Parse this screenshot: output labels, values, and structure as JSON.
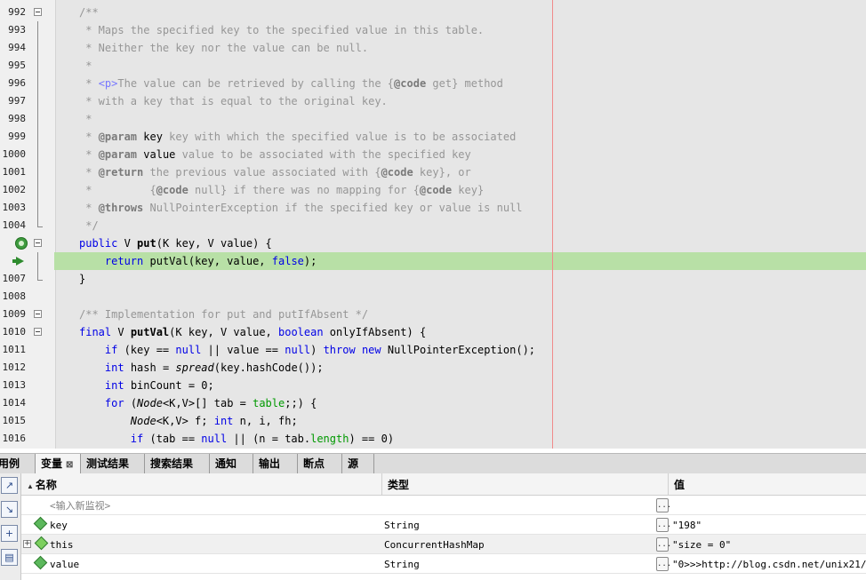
{
  "editor": {
    "lines": [
      {
        "n": "992",
        "parts": [
          {
            "t": "/**",
            "c": "cm"
          }
        ]
      },
      {
        "n": "993",
        "parts": [
          {
            "t": " * Maps the specified key to the specified value in this table.",
            "c": "cm"
          }
        ]
      },
      {
        "n": "994",
        "parts": [
          {
            "t": " * Neither the key nor the value can be null.",
            "c": "cm"
          }
        ]
      },
      {
        "n": "995",
        "parts": [
          {
            "t": " *",
            "c": "cm"
          }
        ]
      },
      {
        "n": "996",
        "parts": [
          {
            "t": " * ",
            "c": "cm"
          },
          {
            "t": "<p>",
            "c": "tag"
          },
          {
            "t": "The value can be retrieved by calling the {",
            "c": "cm"
          },
          {
            "t": "@code",
            "c": "cb"
          },
          {
            "t": " get} method",
            "c": "cm"
          }
        ]
      },
      {
        "n": "997",
        "parts": [
          {
            "t": " * with a key that is equal to the original key.",
            "c": "cm"
          }
        ]
      },
      {
        "n": "998",
        "parts": [
          {
            "t": " *",
            "c": "cm"
          }
        ]
      },
      {
        "n": "999",
        "parts": [
          {
            "t": " * ",
            "c": "cm"
          },
          {
            "t": "@param",
            "c": "cb"
          },
          {
            "t": " key",
            "c": "ck"
          },
          {
            "t": " key with which the specified value is to be associated",
            "c": "cm"
          }
        ]
      },
      {
        "n": "1000",
        "parts": [
          {
            "t": " * ",
            "c": "cm"
          },
          {
            "t": "@param",
            "c": "cb"
          },
          {
            "t": " value",
            "c": "ck"
          },
          {
            "t": " value to be associated with the specified key",
            "c": "cm"
          }
        ]
      },
      {
        "n": "1001",
        "parts": [
          {
            "t": " * ",
            "c": "cm"
          },
          {
            "t": "@return",
            "c": "cb"
          },
          {
            "t": " the previous value associated with {",
            "c": "cm"
          },
          {
            "t": "@code",
            "c": "cb"
          },
          {
            "t": " key}, or",
            "c": "cm"
          }
        ]
      },
      {
        "n": "1002",
        "parts": [
          {
            "t": " *         {",
            "c": "cm"
          },
          {
            "t": "@code",
            "c": "cb"
          },
          {
            "t": " null} if there was no mapping for {",
            "c": "cm"
          },
          {
            "t": "@code",
            "c": "cb"
          },
          {
            "t": " key}",
            "c": "cm"
          }
        ]
      },
      {
        "n": "1003",
        "parts": [
          {
            "t": " * ",
            "c": "cm"
          },
          {
            "t": "@throws",
            "c": "cb"
          },
          {
            "t": " NullPointerException if the specified key or value is null",
            "c": "cm"
          }
        ]
      },
      {
        "n": "1004",
        "parts": [
          {
            "t": " */",
            "c": "cm"
          }
        ]
      },
      {
        "n": "",
        "parts": [
          {
            "t": "public",
            "c": "kw"
          },
          {
            "t": " V ",
            "c": ""
          },
          {
            "t": "put",
            "c": "fn"
          },
          {
            "t": "(K key, V value) {",
            "c": ""
          }
        ]
      },
      {
        "n": "",
        "parts": [
          {
            "t": "    ",
            "c": ""
          },
          {
            "t": "return",
            "c": "kw"
          },
          {
            "t": " putVal(key, value, ",
            "c": ""
          },
          {
            "t": "false",
            "c": "kw"
          },
          {
            "t": ");",
            "c": ""
          }
        ]
      },
      {
        "n": "1007",
        "parts": [
          {
            "t": "}",
            "c": ""
          }
        ]
      },
      {
        "n": "1008",
        "parts": []
      },
      {
        "n": "1009",
        "parts": [
          {
            "t": "/** Implementation for put and putIfAbsent */",
            "c": "cm"
          }
        ]
      },
      {
        "n": "1010",
        "parts": [
          {
            "t": "final",
            "c": "kw"
          },
          {
            "t": " V ",
            "c": ""
          },
          {
            "t": "putVal",
            "c": "fn"
          },
          {
            "t": "(K key, V value, ",
            "c": ""
          },
          {
            "t": "boolean",
            "c": "kw"
          },
          {
            "t": " onlyIfAbsent) {",
            "c": ""
          }
        ]
      },
      {
        "n": "1011",
        "parts": [
          {
            "t": "    ",
            "c": ""
          },
          {
            "t": "if",
            "c": "kw"
          },
          {
            "t": " (key == ",
            "c": ""
          },
          {
            "t": "null",
            "c": "kw"
          },
          {
            "t": " || value == ",
            "c": ""
          },
          {
            "t": "null",
            "c": "kw"
          },
          {
            "t": ") ",
            "c": ""
          },
          {
            "t": "throw",
            "c": "kw"
          },
          {
            "t": " ",
            "c": ""
          },
          {
            "t": "new",
            "c": "kw"
          },
          {
            "t": " NullPointerException();",
            "c": ""
          }
        ]
      },
      {
        "n": "1012",
        "parts": [
          {
            "t": "    ",
            "c": ""
          },
          {
            "t": "int",
            "c": "kw"
          },
          {
            "t": " hash = ",
            "c": ""
          },
          {
            "t": "spread",
            "c": "it"
          },
          {
            "t": "(key.hashCode());",
            "c": ""
          }
        ]
      },
      {
        "n": "1013",
        "parts": [
          {
            "t": "    ",
            "c": ""
          },
          {
            "t": "int",
            "c": "kw"
          },
          {
            "t": " binCount = 0;",
            "c": ""
          }
        ]
      },
      {
        "n": "1014",
        "parts": [
          {
            "t": "    ",
            "c": ""
          },
          {
            "t": "for",
            "c": "kw"
          },
          {
            "t": " (",
            "c": ""
          },
          {
            "t": "Node",
            "c": "it"
          },
          {
            "t": "<K,V>[] tab = ",
            "c": ""
          },
          {
            "t": "table",
            "c": "fld"
          },
          {
            "t": ";;) {",
            "c": ""
          }
        ]
      },
      {
        "n": "1015",
        "parts": [
          {
            "t": "        ",
            "c": ""
          },
          {
            "t": "Node",
            "c": "it"
          },
          {
            "t": "<K,V> f; ",
            "c": ""
          },
          {
            "t": "int",
            "c": "kw"
          },
          {
            "t": " n, i, fh;",
            "c": ""
          }
        ]
      },
      {
        "n": "1016",
        "parts": [
          {
            "t": "        ",
            "c": ""
          },
          {
            "t": "if",
            "c": "kw"
          },
          {
            "t": " (tab == ",
            "c": ""
          },
          {
            "t": "null",
            "c": "kw"
          },
          {
            "t": " || (n = tab.",
            "c": ""
          },
          {
            "t": "length",
            "c": "fld"
          },
          {
            "t": ") == 0)",
            "c": ""
          }
        ]
      }
    ],
    "gutter_markers": [
      {
        "line_index": 0,
        "type": "fold-open"
      },
      {
        "line_index": 1,
        "type": "fold-line"
      },
      {
        "line_index": 2,
        "type": "fold-line"
      },
      {
        "line_index": 3,
        "type": "fold-line"
      },
      {
        "line_index": 4,
        "type": "fold-line"
      },
      {
        "line_index": 5,
        "type": "fold-line"
      },
      {
        "line_index": 6,
        "type": "fold-line"
      },
      {
        "line_index": 7,
        "type": "fold-line"
      },
      {
        "line_index": 8,
        "type": "fold-line"
      },
      {
        "line_index": 9,
        "type": "fold-line"
      },
      {
        "line_index": 10,
        "type": "fold-line"
      },
      {
        "line_index": 11,
        "type": "fold-line"
      },
      {
        "line_index": 12,
        "type": "fold-end"
      },
      {
        "line_index": 13,
        "type": "breakpoint-icon"
      },
      {
        "line_index": 13,
        "type": "fold-open"
      },
      {
        "line_index": 14,
        "type": "current-line-arrow"
      },
      {
        "line_index": 14,
        "type": "fold-line"
      },
      {
        "line_index": 15,
        "type": "fold-end"
      },
      {
        "line_index": 17,
        "type": "fold-open"
      },
      {
        "line_index": 18,
        "type": "fold-open"
      }
    ],
    "current_line_index": 14
  },
  "tabs": [
    {
      "label": "用例",
      "active": false
    },
    {
      "label": "变量",
      "active": true,
      "close": "⊠"
    },
    {
      "label": "测试结果",
      "active": false
    },
    {
      "label": "搜索结果",
      "active": false
    },
    {
      "label": "通知",
      "active": false
    },
    {
      "label": "输出",
      "active": false
    },
    {
      "label": "断点",
      "active": false
    },
    {
      "label": "源",
      "active": false
    }
  ],
  "variables": {
    "columns": {
      "name": "名称",
      "type": "类型",
      "value": "值"
    },
    "watch_placeholder": "<输入新监视>",
    "rows": [
      {
        "name": "key",
        "type": "String",
        "value": "\"198\"",
        "expandable": false,
        "icon": "variable-icon"
      },
      {
        "name": "this",
        "type": "ConcurrentHashMap",
        "value": "\"size = 0\"",
        "expandable": true,
        "icon": "field-variable-icon"
      },
      {
        "name": "value",
        "type": "String",
        "value": "\"0>>>http://blog.csdn.net/unix21/\"",
        "expandable": false,
        "icon": "variable-icon"
      }
    ],
    "ellipsis_label": "...",
    "toolbar_icons": [
      "step-over-icon",
      "step-into-icon",
      "new-watch-icon",
      "debug-window-icon"
    ]
  }
}
